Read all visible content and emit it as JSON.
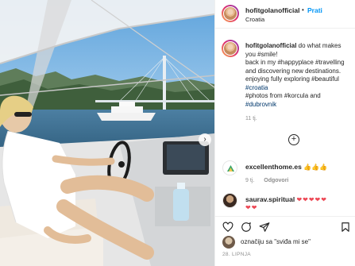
{
  "post": {
    "username": "hofitgolanofficial",
    "separator": "•",
    "follow_label": "Prati",
    "location": "Croatia",
    "caption_username": "hofitgolanofficial",
    "caption_line1": "do what makes",
    "caption_line2": "you #smile!",
    "caption_line3": "back in my #happyplace #travelling",
    "caption_line4": "and discovering new destinations.",
    "caption_line5": "enjoying fully exploring #beautiful",
    "caption_line6": "#croatia",
    "caption_line7": "#photos from #korcula and",
    "caption_line8": "#dubrovnik",
    "caption_time": "11 tj."
  },
  "comments": [
    {
      "username": "excellenthome.es",
      "text": "👍👍👍",
      "time": "9 tj.",
      "reply_label": "Odgovori"
    },
    {
      "username": "saurav.spiritual",
      "text": "❤❤❤❤❤",
      "text2": "❤❤"
    }
  ],
  "footer": {
    "likes_text": "označiju sa \"sviđa mi se\"",
    "date": "28. LIPNJA"
  },
  "icons": {
    "like": "heart-icon",
    "comment": "comment-icon",
    "share": "share-icon",
    "save": "bookmark-icon",
    "more_comments": "plus-circle-icon",
    "next": "chevron-right-icon"
  },
  "colors": {
    "follow_blue": "#0095f6",
    "hashtag": "#00376b",
    "heart_red": "#ed4956",
    "muted": "#8e8e8e"
  }
}
